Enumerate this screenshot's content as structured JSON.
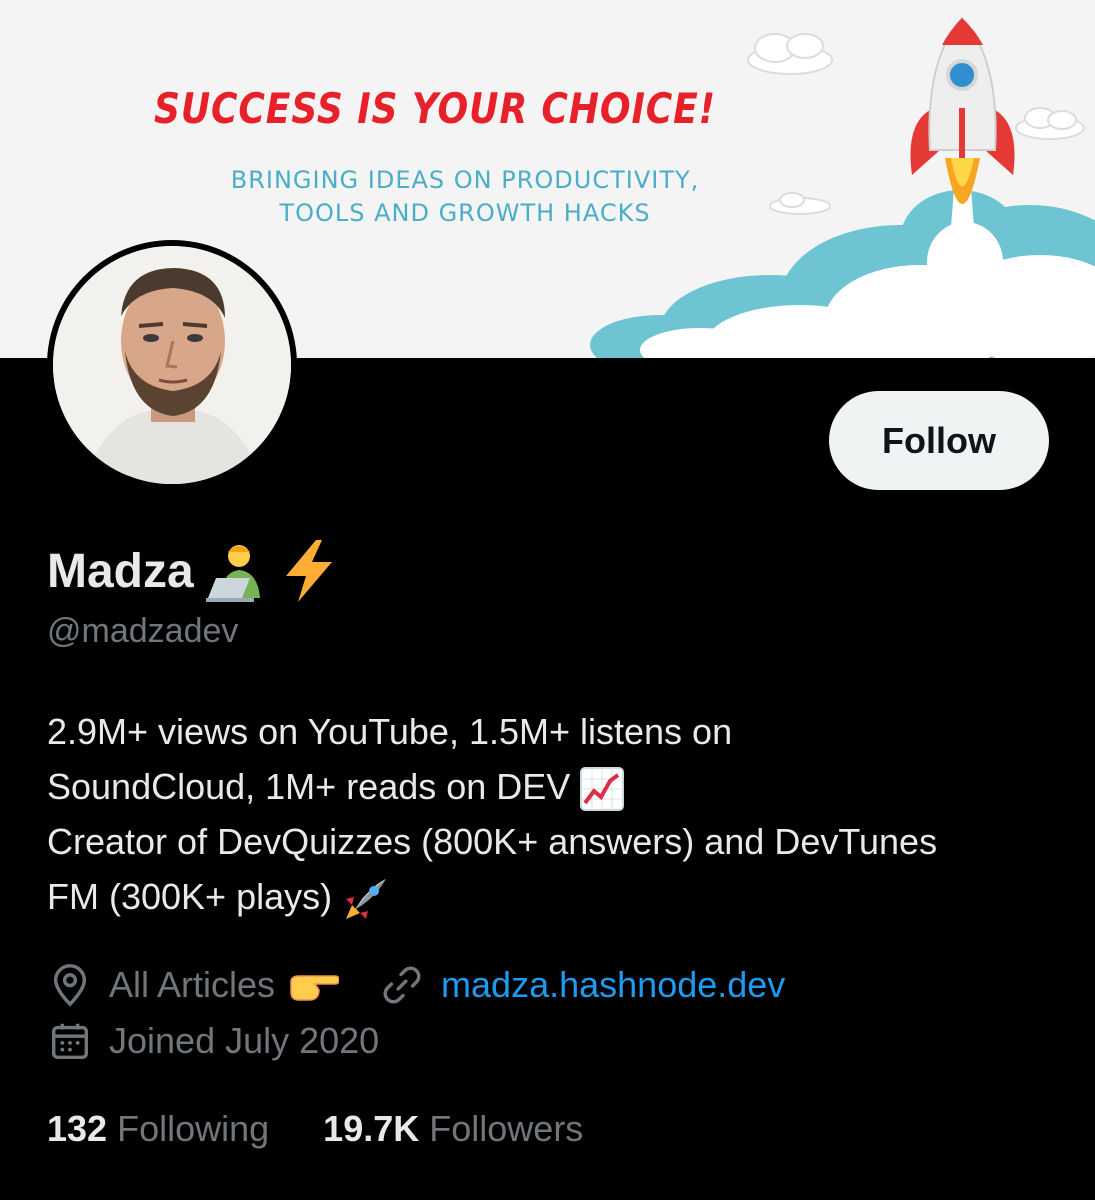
{
  "banner": {
    "headline": "SUCCESS IS YOUR CHOICE!",
    "subline_1": "BRINGING IDEAS ON PRODUCTIVITY,",
    "subline_2": "TOOLS AND GROWTH HACKS",
    "headline_color": "#e8202a",
    "subline_color": "#4aaec6"
  },
  "profile": {
    "display_name": "Madza",
    "name_emoji_1": "technologist-emoji",
    "name_emoji_2": "lightning-emoji",
    "handle": "@madzadev",
    "follow_label": "Follow",
    "bio_line_1": "2.9M+ views on YouTube, 1.5M+ listens on",
    "bio_line_2": "SoundCloud, 1M+ reads on DEV",
    "bio_line_3": "Creator of DevQuizzes (800K+ answers) and DevTunes",
    "bio_line_4": "FM (300K+ plays)",
    "location": "All Articles",
    "website": "madza.hashnode.dev",
    "joined": "Joined July 2020",
    "following_count": "132",
    "following_label": "Following",
    "followers_count": "19.7K",
    "followers_label": "Followers"
  },
  "colors": {
    "background": "#000000",
    "text": "#e7e9ea",
    "muted": "#71767b",
    "link": "#1d9bf0",
    "button_bg": "#eff3f4"
  }
}
